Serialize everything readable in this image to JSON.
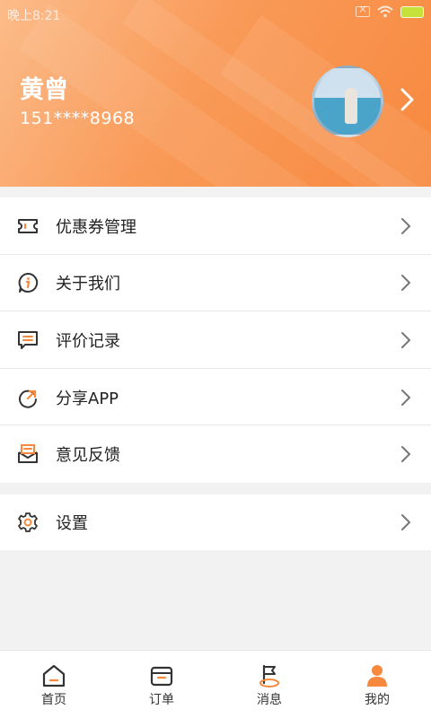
{
  "status_bar": {
    "time": "晚上8:21"
  },
  "profile": {
    "name": "黄曾",
    "phone": "151****8968"
  },
  "menu": {
    "items": [
      {
        "label": "优惠券管理",
        "icon": "coupon-icon"
      },
      {
        "label": "关于我们",
        "icon": "info-icon"
      },
      {
        "label": "评价记录",
        "icon": "comment-icon"
      },
      {
        "label": "分享APP",
        "icon": "share-icon"
      },
      {
        "label": "意见反馈",
        "icon": "feedback-mail-icon"
      }
    ],
    "settings": {
      "label": "设置",
      "icon": "gear-icon"
    }
  },
  "tabbar": {
    "tabs": [
      {
        "label": "首页",
        "icon": "home-icon"
      },
      {
        "label": "订单",
        "icon": "order-box-icon"
      },
      {
        "label": "消息",
        "icon": "flag-icon"
      },
      {
        "label": "我的",
        "icon": "person-icon",
        "active": true
      }
    ]
  },
  "colors": {
    "accent": "#f7893f",
    "icon_dark": "#333333"
  }
}
